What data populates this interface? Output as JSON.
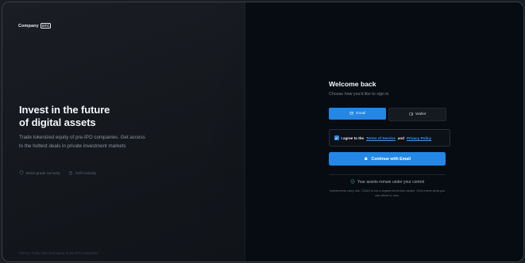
{
  "brand": {
    "name": "Company",
    "badge": "OTC"
  },
  "hero": {
    "title_line1": "Invest in the future",
    "title_line2": "of digital assets",
    "subtitle": "Trade tokenized equity of pre-IPO companies. Get access to the hottest deals in private investment markets"
  },
  "features": [
    {
      "icon": "shield-icon",
      "label": "Bank-grade security"
    },
    {
      "icon": "lock-icon",
      "label": "Self-custody"
    }
  ],
  "footer": "CDAO | Trade tokenized equity of pre-IPO companies",
  "signin": {
    "title": "Welcome back",
    "subtitle": "Choose how you'd like to sign in",
    "tabs": [
      {
        "icon": "mail-icon",
        "label": "Email",
        "active": true
      },
      {
        "icon": "wallet-icon",
        "label": "Wallet",
        "active": false
      }
    ],
    "agree": {
      "prefix": "I agree to the",
      "terms": "Terms of Service",
      "and": "and",
      "privacy": "Privacy Policy",
      "checked": true
    },
    "continue_label": "Continue with Email",
    "control_text": "Your assets remain under your control",
    "disclaimer": "Investments carry risk. CDAO is not a registered broker-dealer. Only invest what you can afford to lose."
  },
  "colors": {
    "accent": "#2487e5",
    "background": "#070b12",
    "link": "#3b96ef"
  }
}
